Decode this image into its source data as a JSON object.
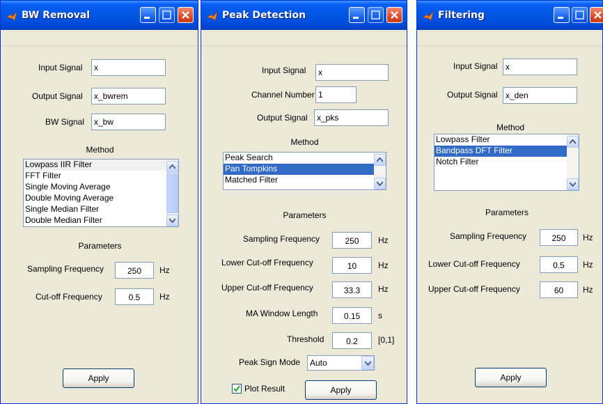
{
  "windows": {
    "bw": {
      "title": "BW Removal",
      "input_label": "Input Signal",
      "input_value": "x",
      "output_label": "Output Signal",
      "output_value": "x_bwrem",
      "bw_label": "BW Signal",
      "bw_value": "x_bw",
      "method_label": "Method",
      "methods": [
        "Lowpass IIR Filter",
        "FFT Filter",
        "Single Moving Average",
        "Double Moving Average",
        "Single Median Filter",
        "Double Median Filter"
      ],
      "params_label": "Parameters",
      "fs_label": "Sampling Frequency",
      "fs_value": "250",
      "fs_unit": "Hz",
      "fc_label": "Cut-off Frequency",
      "fc_value": "0.5",
      "fc_unit": "Hz",
      "apply": "Apply"
    },
    "peak": {
      "title": "Peak Detection",
      "input_label": "Input Signal",
      "input_value": "x",
      "channel_label": "Channel Number",
      "channel_value": "1",
      "output_label": "Output Signal",
      "output_value": "x_pks",
      "method_label": "Method",
      "methods": [
        "Peak Search",
        "Pan Tompkins",
        "Matched Filter"
      ],
      "selected_method": "Pan Tompkins",
      "params_label": "Parameters",
      "fs_label": "Sampling Frequency",
      "fs_value": "250",
      "fs_unit": "Hz",
      "lower_label": "Lower Cut-off Frequency",
      "lower_value": "10",
      "lower_unit": "Hz",
      "upper_label": "Upper Cut-off Frequency",
      "upper_value": "33.3",
      "upper_unit": "Hz",
      "ma_label": "MA Window Length",
      "ma_value": "0.15",
      "ma_unit": "s",
      "thr_label": "Threshold",
      "thr_value": "0.2",
      "thr_unit": "[0,1]",
      "sign_label": "Peak Sign Mode",
      "sign_value": "Auto",
      "plot_label": "Plot Result",
      "plot_checked": true,
      "apply": "Apply"
    },
    "filt": {
      "title": "Filtering",
      "input_label": "Input Signal",
      "input_value": "x",
      "output_label": "Output Signal",
      "output_value": "x_den",
      "method_label": "Method",
      "methods": [
        "Lowpass Filter",
        "Bandpass DFT Filter",
        "Notch Filter"
      ],
      "selected_method": "Bandpass DFT Filter",
      "params_label": "Parameters",
      "fs_label": "Sampling Frequency",
      "fs_value": "250",
      "fs_unit": "Hz",
      "lower_label": "Lower Cut-off Frequency",
      "lower_value": "0.5",
      "lower_unit": "Hz",
      "upper_label": "Upper Cut-off Frequency",
      "upper_value": "60",
      "upper_unit": "Hz",
      "apply": "Apply"
    }
  },
  "icons": {
    "title": "matlab-icon",
    "minimize": "minimize-icon",
    "maximize": "maximize-icon",
    "close": "close-icon"
  }
}
